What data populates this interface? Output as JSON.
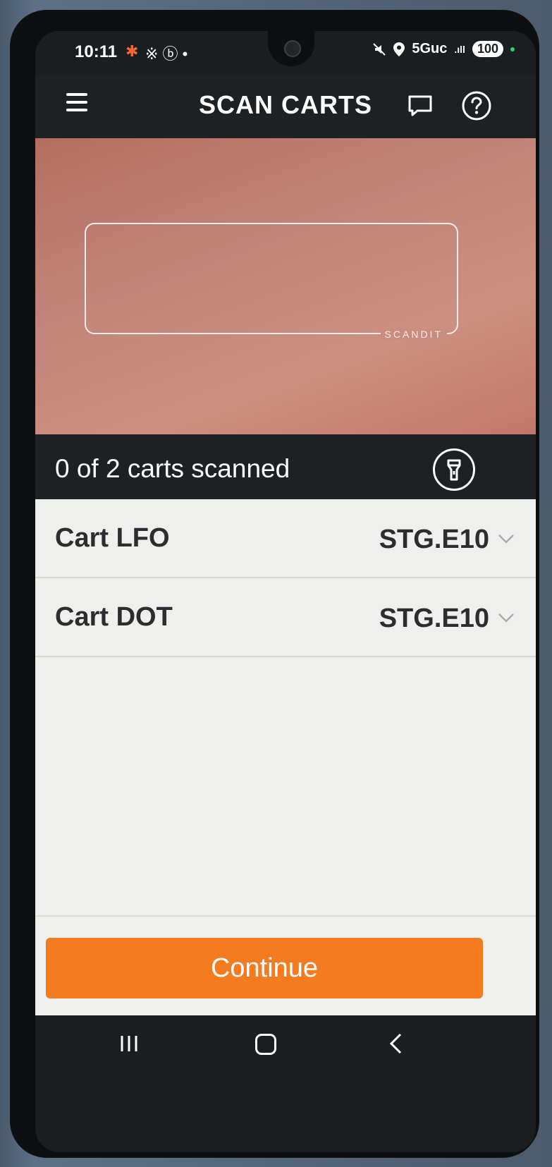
{
  "status_bar": {
    "time": "10:11",
    "bluetooth_glyph": "✱",
    "misc_glyphs": "※ ⓑ •",
    "network": "5Guc",
    "signal_glyph": ".ıll",
    "battery": "100"
  },
  "header": {
    "title": "SCAN CARTS",
    "menu_icon": "hamburger-icon",
    "feedback_icon": "chat-bubble-icon",
    "help_icon": "help-circle-icon"
  },
  "scanner": {
    "logo": "SCANDIT"
  },
  "scan_status": {
    "text": "0 of 2 carts scanned",
    "torch_icon": "flashlight-icon"
  },
  "carts": [
    {
      "name": "Cart LFO",
      "destination": "STG.E10"
    },
    {
      "name": "Cart DOT",
      "destination": "STG.E10"
    }
  ],
  "footer": {
    "continue_label": "Continue"
  },
  "colors": {
    "accent": "#f47b20",
    "header_bg": "#1e2124",
    "list_bg": "#efefed"
  }
}
